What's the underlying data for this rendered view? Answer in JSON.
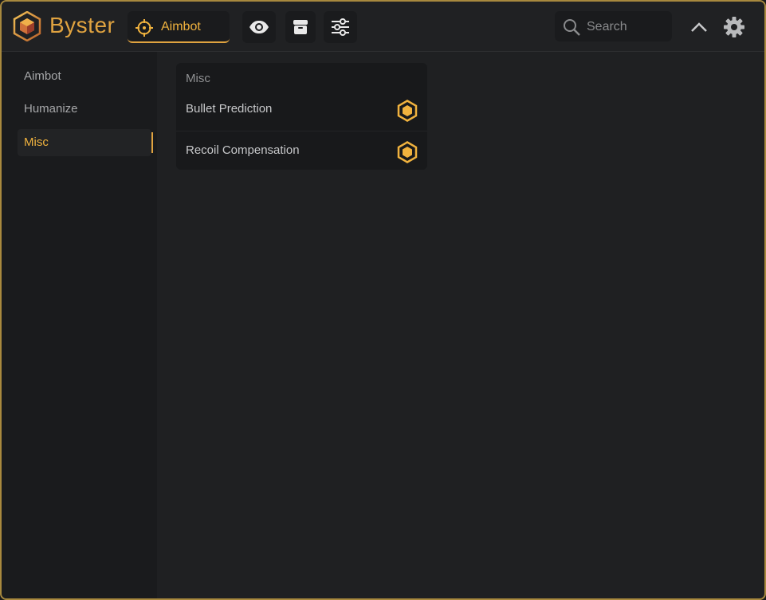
{
  "app": {
    "name": "Byster",
    "accent_color": "#e0a340"
  },
  "topbar": {
    "active_tab": {
      "label": "Aimbot",
      "icon": "crosshair-icon"
    },
    "icon_buttons": [
      "eye-icon",
      "box-icon",
      "sliders-icon"
    ],
    "search": {
      "placeholder": "Search",
      "value": ""
    },
    "collapse_icon": "chevron-up-icon",
    "settings_icon": "gear-icon"
  },
  "sidebar": {
    "items": [
      {
        "label": "Aimbot",
        "active": false
      },
      {
        "label": "Humanize",
        "active": false
      },
      {
        "label": "Misc",
        "active": true
      }
    ]
  },
  "panel": {
    "title": "Misc",
    "rows": [
      {
        "label": "Bullet Prediction",
        "toggle_icon": "hexagon-toggle-icon",
        "enabled": true
      },
      {
        "label": "Recoil Compensation",
        "toggle_icon": "hexagon-toggle-icon",
        "enabled": true
      }
    ]
  }
}
